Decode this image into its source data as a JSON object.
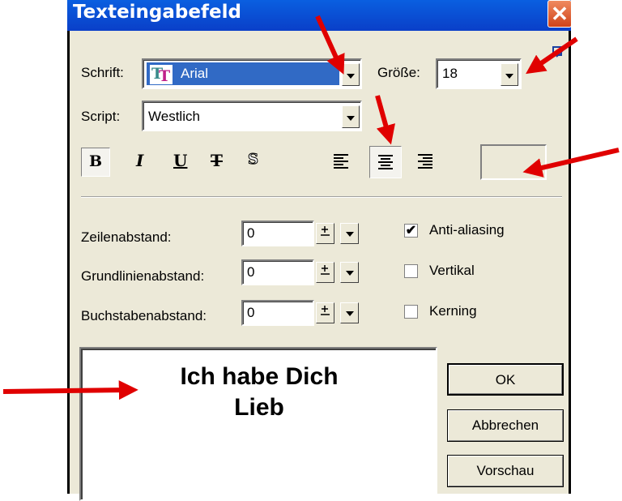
{
  "window": {
    "title": "Texteingabefeld",
    "close_glyph": "✕"
  },
  "font": {
    "label": "Schrift:",
    "value": "Arial",
    "icon": "truetype-font-icon"
  },
  "size": {
    "label": "Größe:",
    "value": "18"
  },
  "script": {
    "label": "Script:",
    "value": "Westlich"
  },
  "style_buttons": [
    {
      "name": "bold",
      "glyph": "B"
    },
    {
      "name": "italic",
      "glyph": "I"
    },
    {
      "name": "underline",
      "glyph": "U"
    },
    {
      "name": "strikethrough",
      "glyph": "T"
    },
    {
      "name": "outline",
      "glyph": "S"
    }
  ],
  "spacing": [
    {
      "label": "Zeilenabstand:",
      "value": "0"
    },
    {
      "label": "Grundlinienabstand:",
      "value": "0"
    },
    {
      "label": "Buchstabenabstand:",
      "value": "0"
    }
  ],
  "options": [
    {
      "label": "Anti-aliasing",
      "checked": true,
      "mark": "✔"
    },
    {
      "label": "Vertikal",
      "checked": false,
      "mark": ""
    },
    {
      "label": "Kerning",
      "checked": false,
      "mark": ""
    }
  ],
  "preview_text": {
    "line1": "Ich habe Dich",
    "line2": "Lieb"
  },
  "buttons": {
    "ok": "OK",
    "cancel": "Abbrechen",
    "preview": "Vorschau"
  },
  "colors": {
    "titlebar": "#0a4fd8",
    "dialog_bg": "#ece9d8",
    "font_selection": "#316ac5",
    "annotation_arrow": "#e00000"
  }
}
